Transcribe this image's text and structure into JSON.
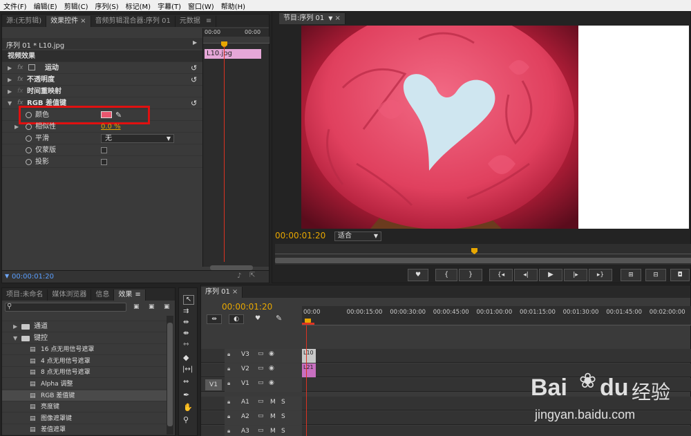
{
  "menu": [
    "文件(F)",
    "编辑(E)",
    "剪辑(C)",
    "序列(S)",
    "标记(M)",
    "字幕(T)",
    "窗口(W)",
    "帮助(H)"
  ],
  "fx_panel": {
    "tabs": [
      {
        "label": "源:(无剪辑)",
        "active": false
      },
      {
        "label": "效果控件",
        "active": true,
        "close": "×"
      },
      {
        "label": "音频剪辑混合器:序列 01",
        "active": false
      },
      {
        "label": "元数据",
        "active": false
      }
    ],
    "menu_icon": "≡",
    "clip_title": "序列 01 * L10.jpg",
    "tl_start": "00:00",
    "tl_end": "00:00",
    "clip_bar": "L10.jpg",
    "section": "视频效果",
    "effects": [
      {
        "fx": "fx",
        "name": "运动",
        "expanded": false
      },
      {
        "fx": "fx",
        "name": "不透明度",
        "expanded": false
      },
      {
        "fx": "fx",
        "name": "时间重映射",
        "expanded": false
      },
      {
        "fx": "fx",
        "name": "RGB 差值键",
        "expanded": true
      }
    ],
    "params": [
      {
        "name": "颜色",
        "type": "color",
        "value": "#e8566e"
      },
      {
        "name": "相似性",
        "type": "number",
        "value": "0.0",
        "unit": "%"
      },
      {
        "name": "平滑",
        "type": "select",
        "value": "无"
      },
      {
        "name": "仅蒙版",
        "type": "checkbox"
      },
      {
        "name": "投影",
        "type": "checkbox"
      }
    ],
    "timecode": "00:00:01:20"
  },
  "program": {
    "tab": "节目:序列 01",
    "timecode": "00:00:01:20",
    "fit": "适合",
    "image_alt": "cupcake"
  },
  "project": {
    "tabs": [
      {
        "label": "项目:未命名",
        "active": false
      },
      {
        "label": "媒体浏览器",
        "active": false
      },
      {
        "label": "信息",
        "active": false
      },
      {
        "label": "效果",
        "active": true
      }
    ],
    "items": [
      {
        "label": "通道",
        "type": "folder",
        "level": 1
      },
      {
        "label": "键控",
        "type": "folder",
        "level": 1,
        "open": true
      },
      {
        "label": "16 点无用信号遮罩",
        "type": "effect",
        "level": 2
      },
      {
        "label": "4 点无用信号遮罩",
        "type": "effect",
        "level": 2
      },
      {
        "label": "8 点无用信号遮罩",
        "type": "effect",
        "level": 2
      },
      {
        "label": "Alpha 调整",
        "type": "effect",
        "level": 2
      },
      {
        "label": "RGB 差值键",
        "type": "effect",
        "level": 2,
        "selected": true
      },
      {
        "label": "亮度键",
        "type": "effect",
        "level": 2
      },
      {
        "label": "图像遮罩键",
        "type": "effect",
        "level": 2
      },
      {
        "label": "差值遮罩",
        "type": "effect",
        "level": 2
      }
    ]
  },
  "timeline": {
    "tab": "序列 01",
    "timecode": "00:00:01:20",
    "ruler": [
      "00:00",
      "00:00:15:00",
      "00:00:30:00",
      "00:00:45:00",
      "00:01:00:00",
      "00:01:15:00",
      "00:01:30:00",
      "00:01:45:00",
      "00:02:00:00"
    ],
    "tracks": [
      {
        "label": "V3",
        "clip": "L10"
      },
      {
        "label": "V2",
        "clip": "L21"
      },
      {
        "label": "V1",
        "source": "V1",
        "clip": ""
      },
      {
        "label": "A1"
      },
      {
        "label": "A2"
      },
      {
        "label": "A3"
      }
    ],
    "audio_buttons": [
      "M",
      "S"
    ]
  },
  "watermark": {
    "brand": "Bai",
    "brand2": "du",
    "cn": "经验",
    "url": "jingyan.baidu.com"
  }
}
